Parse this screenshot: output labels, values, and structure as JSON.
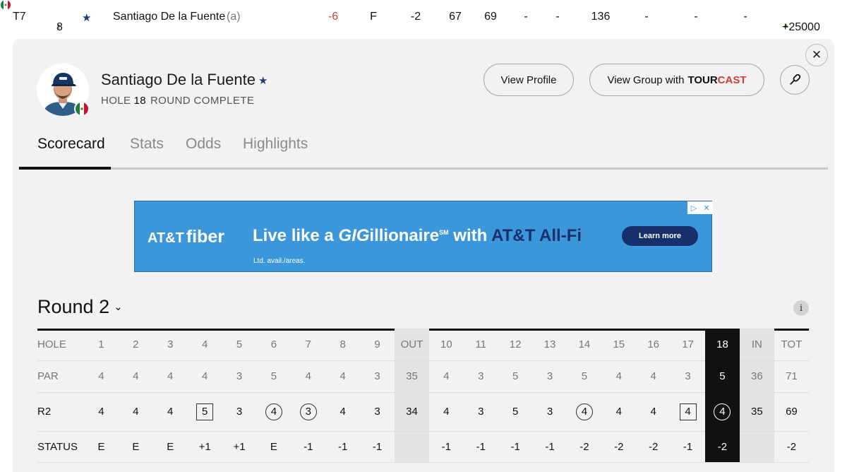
{
  "leaderboard_row": {
    "position": "T7",
    "movement": "8",
    "player": "Santiago De la Fuente",
    "amateur": "(a)",
    "to_par": "-6",
    "thru": "F",
    "today": "-2",
    "r1": "67",
    "r2": "69",
    "r3": "-",
    "r4": "-",
    "total": "136",
    "extra": [
      "-",
      "-",
      "-"
    ],
    "odds": "+25000"
  },
  "player_panel": {
    "name": "Santiago De la Fuente",
    "hole_label": "HOLE",
    "hole_number": "18",
    "round_status": "ROUND COMPLETE",
    "view_profile": "View Profile",
    "view_group_prefix": "View Group with",
    "tour_word": "TOUR",
    "cast_word": "CAST",
    "close_symbol": "✕"
  },
  "tabs": [
    "Scorecard",
    "Stats",
    "Odds",
    "Highlights"
  ],
  "active_tab": "Scorecard",
  "ad": {
    "logo_att": "AT&T",
    "logo_fiber": "fiber",
    "headline_a": "Live like a ",
    "headline_gig": "GIG",
    "headline_b": "illionaire",
    "headline_sm": "SM",
    "headline_c": " with ",
    "headline_brand": "AT&T All-Fi",
    "fine_print": "Ltd. avail./areas.",
    "cta": "Learn more"
  },
  "round_selector": {
    "label": "Round 2",
    "info": "i"
  },
  "scorecard": {
    "hole_label": "HOLE",
    "par_label": "PAR",
    "score_label": "R2",
    "status_label": "STATUS",
    "columns": [
      "1",
      "2",
      "3",
      "4",
      "5",
      "6",
      "7",
      "8",
      "9",
      "OUT",
      "10",
      "11",
      "12",
      "13",
      "14",
      "15",
      "16",
      "17",
      "18",
      "IN",
      "TOT"
    ],
    "par": [
      "4",
      "4",
      "4",
      "4",
      "3",
      "5",
      "4",
      "4",
      "3",
      "35",
      "4",
      "3",
      "5",
      "3",
      "5",
      "4",
      "4",
      "3",
      "5",
      "36",
      "71"
    ],
    "scores": [
      "4",
      "4",
      "4",
      "5",
      "3",
      "4",
      "3",
      "4",
      "3",
      "34",
      "4",
      "3",
      "5",
      "3",
      "4",
      "4",
      "4",
      "4",
      "4",
      "35",
      "69"
    ],
    "score_marks": [
      "",
      "",
      "",
      "bogey",
      "",
      "birdie",
      "birdie",
      "",
      "",
      "",
      "",
      "",
      "",
      "",
      "birdie",
      "",
      "",
      "bogey",
      "birdie",
      "",
      ""
    ],
    "status": [
      "E",
      "E",
      "E",
      "+1",
      "+1",
      "E",
      "-1",
      "-1",
      "-1",
      "",
      "-1",
      "-1",
      "-1",
      "-1",
      "-2",
      "-2",
      "-2",
      "-1",
      "-2",
      "",
      "-2"
    ],
    "subtotal_columns": [
      "OUT",
      "IN"
    ],
    "current_hole": "18"
  },
  "colors": {
    "panel_bg": "#f2f2f2",
    "under_par": "#d23f31",
    "movement_up": "#2b8a3e",
    "ad_bg": "#3b97d9",
    "ad_navy": "#17306b"
  }
}
